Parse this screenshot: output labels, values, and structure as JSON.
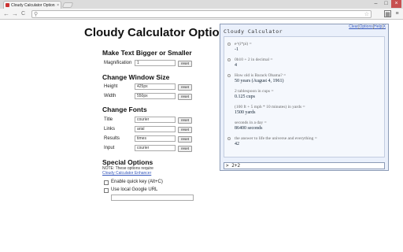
{
  "browser": {
    "tab_title": "Cloudy Calculator Options",
    "tab_close": "×",
    "window_buttons": [
      "–",
      "□",
      "×"
    ],
    "back": "←",
    "forward": "→",
    "reload": "C",
    "url": "",
    "star": "☆",
    "wrench": "≡"
  },
  "options": {
    "page_title": "Cloudy Calculator Options",
    "text_size": {
      "heading": "Make Text Bigger or Smaller",
      "magnification_label": "Magnification",
      "magnification_value": "1",
      "reset_label": "reset"
    },
    "window_size": {
      "heading": "Change Window Size",
      "height_label": "Height",
      "height_value": "425px",
      "width_label": "Width",
      "width_value": "550px",
      "reset_label": "reset"
    },
    "fonts": {
      "heading": "Change Fonts",
      "title_label": "Title",
      "title_value": "courier",
      "links_label": "Links",
      "links_value": "arial",
      "results_label": "Results",
      "results_value": "times",
      "input_label": "Input",
      "input_value": "courier",
      "reset_label": "reset"
    },
    "special": {
      "heading": "Special Options",
      "note": "NOTE: These options require",
      "note_link": "Cloudy Calculator Enhancer",
      "quick_key_label": "Enable quick key (Alt+C)",
      "google_url_label": "Use local Google URL",
      "google_url_value": ""
    }
  },
  "popup": {
    "title": "Cloudy Calculator",
    "links": {
      "clear": "Clear",
      "options": "Options",
      "help": "Help",
      "close": "X"
    },
    "results": [
      {
        "query": "e^(i*pi) =",
        "answer": "-1",
        "dot": true
      },
      {
        "query": "0b10 + 2 in decimal =",
        "answer": "4",
        "dot": true
      },
      {
        "query": "How old is Barack Obama? =",
        "answer": "50 years (August 4, 1961)",
        "dot": true
      },
      {
        "query": "2 tablespoon in cups =",
        "answer": "0.125 cups",
        "dot": false
      },
      {
        "query": "(100 ft + 5 mph * 10 minutes) in yards =",
        "answer": "1500 yards",
        "dot": false
      },
      {
        "query": "seconds in a day =",
        "answer": "86400 seconds",
        "dot": false
      },
      {
        "query": "the answer to life the universe and everything =",
        "answer": "42",
        "dot": true
      }
    ],
    "input_prompt": ">",
    "input_value": "2+2"
  }
}
